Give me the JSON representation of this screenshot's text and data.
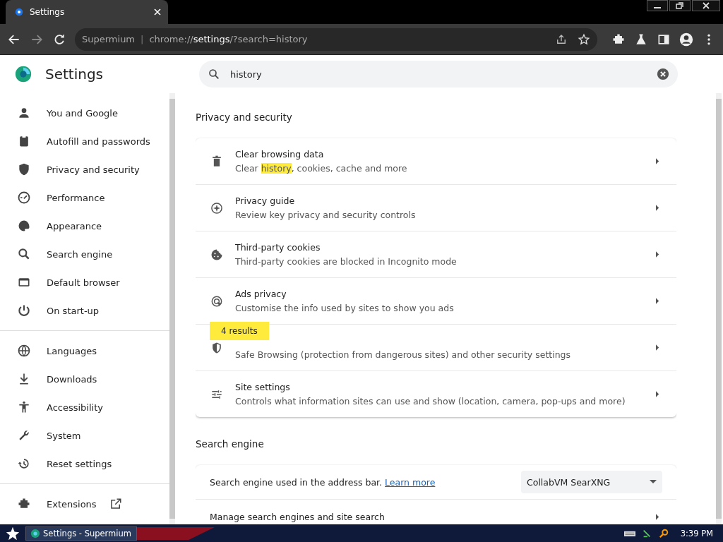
{
  "browser": {
    "tab": {
      "title": "Settings",
      "selected": true
    },
    "address": {
      "site": "Supermium",
      "separator": "|",
      "url_prefix": "chrome://",
      "url_host": "settings",
      "url_rest": "/?search=history"
    }
  },
  "header": {
    "title": "Settings",
    "search": {
      "value": "history"
    }
  },
  "sidebar": {
    "groups": [
      {
        "items": [
          {
            "label": "You and Google",
            "selected": false
          },
          {
            "label": "Autofill and passwords",
            "selected": false
          },
          {
            "label": "Privacy and security",
            "selected": false
          },
          {
            "label": "Performance",
            "selected": false
          },
          {
            "label": "Appearance",
            "selected": false
          },
          {
            "label": "Search engine",
            "selected": false
          },
          {
            "label": "Default browser",
            "selected": false
          },
          {
            "label": "On start-up",
            "selected": false
          }
        ]
      },
      {
        "items": [
          {
            "label": "Languages",
            "selected": false
          },
          {
            "label": "Downloads",
            "selected": false
          },
          {
            "label": "Accessibility",
            "selected": false
          },
          {
            "label": "System",
            "selected": false
          },
          {
            "label": "Reset settings",
            "selected": false
          }
        ]
      },
      {
        "items": [
          {
            "label": "Extensions",
            "selected": false
          }
        ]
      }
    ]
  },
  "sections": [
    {
      "kind": "list",
      "title": "Privacy and security",
      "rows": [
        {
          "title": "Clear browsing data",
          "subtitle": {
            "before": "Clear ",
            "match": "history",
            "after": ", cookies, cache and more"
          }
        },
        {
          "title": "Privacy guide",
          "subtitle": {
            "before": "Review key privacy and security controls"
          }
        },
        {
          "title": "Third-party cookies",
          "subtitle": {
            "before": "Third-party cookies are blocked in Incognito mode"
          }
        },
        {
          "title": "Ads privacy",
          "subtitle": {
            "before": "Customise the info used by sites to show you ads"
          }
        },
        {
          "subtitle": {
            "before": "Safe Browsing (protection from dangerous sites) and other security settings"
          },
          "bubble": "4 results"
        },
        {
          "title": "Site settings",
          "subtitle": {
            "before": "Controls what information sites can use and show (location, camera, pop-ups and more)"
          }
        }
      ]
    },
    {
      "kind": "engine",
      "title": "Search engine",
      "label": "Search engine used in the address bar.",
      "link": "Learn more",
      "dropdown": "CollabVM SearXNG",
      "row": "Manage search engines and site search"
    }
  ],
  "taskbar": {
    "task": "Settings - Supermium",
    "clock": "3:39 PM"
  }
}
